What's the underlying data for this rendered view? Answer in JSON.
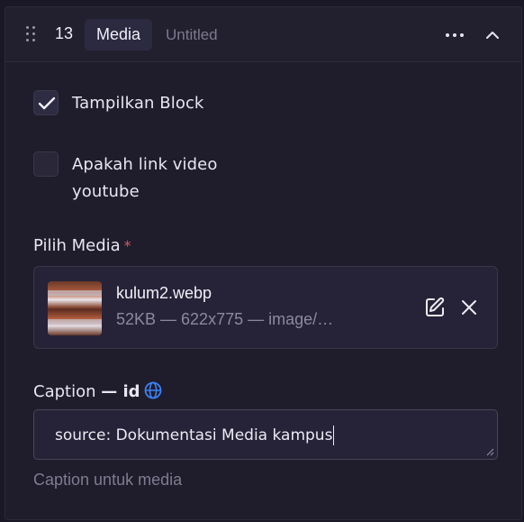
{
  "block": {
    "number": "13",
    "type_label": "Media",
    "title": "Untitled"
  },
  "icons": {
    "drag": "drag-handle-icon",
    "more": "more-horizontal-icon",
    "collapse": "chevron-up-icon",
    "check": "checkmark-icon",
    "edit": "edit-icon",
    "remove": "close-icon",
    "locale": "globe-icon"
  },
  "options": {
    "show_block": {
      "label": "Tampilkan Block",
      "checked": true
    },
    "is_youtube": {
      "label_line1": "Apakah link video",
      "label_line2": "youtube",
      "checked": false
    }
  },
  "media": {
    "label": "Pilih Media",
    "required_mark": "*",
    "file_name": "kulum2.webp",
    "file_meta": "52KB — 622x775 — image/…"
  },
  "caption": {
    "label": "Caption",
    "locale_suffix": "— id",
    "value": "source: Dokumentasi Media kampus",
    "helper": "Caption untuk media"
  },
  "colors": {
    "background": "#1f1c2c",
    "header": "#22202f",
    "accent_globe": "#3b82f6",
    "required": "#d85a5a"
  }
}
